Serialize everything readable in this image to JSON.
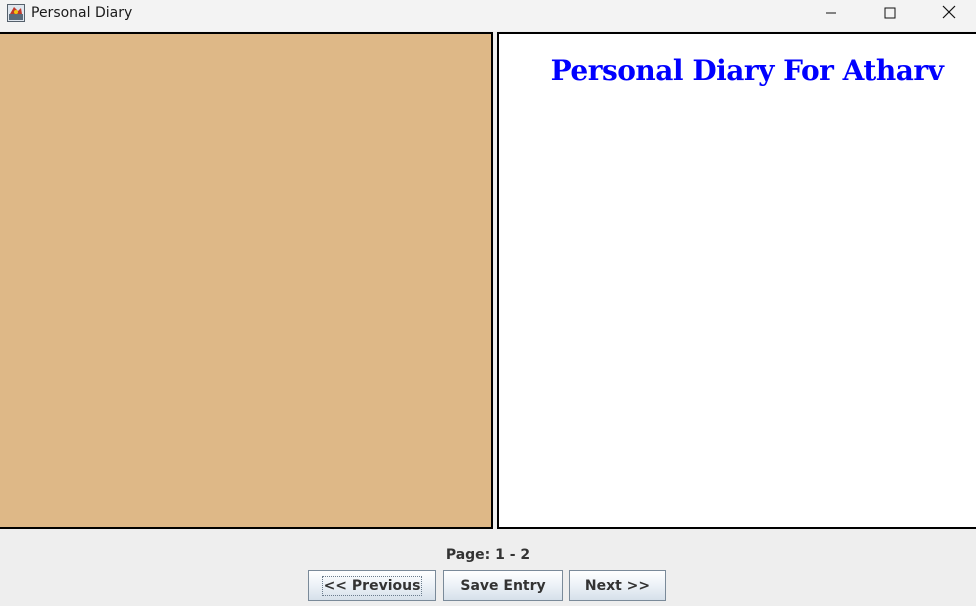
{
  "window": {
    "title": "Personal Diary",
    "icons": {
      "app": "java-app-icon",
      "minimize": "minimize-icon",
      "maximize": "maximize-icon",
      "close": "close-icon"
    }
  },
  "left_panel": {
    "background_color": "#deb887"
  },
  "right_panel": {
    "heading": "Personal Diary For Atharv",
    "heading_color": "#0000ff",
    "background_color": "#ffffff"
  },
  "footer": {
    "page_indicator": "Page: 1 - 2",
    "buttons": {
      "previous": "<< Previous",
      "save": "Save Entry",
      "next": "Next >>"
    }
  }
}
